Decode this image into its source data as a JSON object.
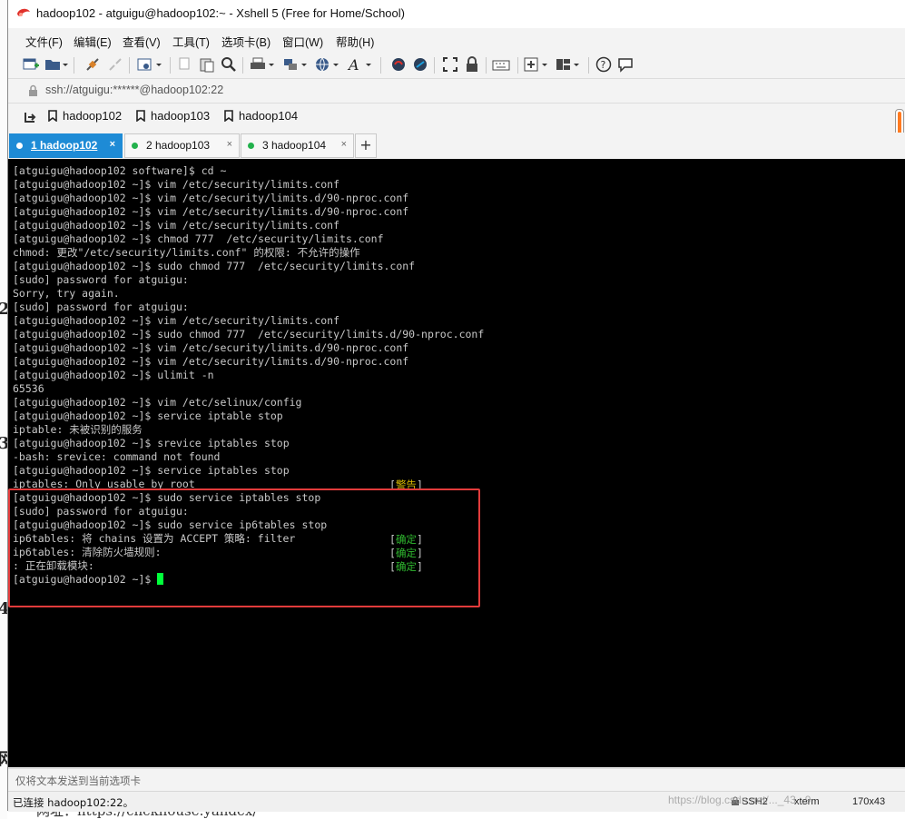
{
  "window": {
    "title": "hadoop102 - atguigu@hadoop102:~ - Xshell 5 (Free for Home/School)"
  },
  "menu": [
    "文件(F)",
    "编辑(E)",
    "查看(V)",
    "工具(T)",
    "选项卡(B)",
    "窗口(W)",
    "帮助(H)"
  ],
  "address": "ssh://atguigu:******@hadoop102:22",
  "links": [
    "hadoop102",
    "hadoop103",
    "hadoop104"
  ],
  "tabs": [
    {
      "label": "1 hadoop102",
      "active": true
    },
    {
      "label": "2 hadoop103",
      "active": false
    },
    {
      "label": "3 hadoop104",
      "active": false
    }
  ],
  "tab_add": "+",
  "tab_close": "×",
  "terminal": {
    "lines": [
      "[atguigu@hadoop102 software]$ cd ~",
      "[atguigu@hadoop102 ~]$ vim /etc/security/limits.conf",
      "[atguigu@hadoop102 ~]$ vim /etc/security/limits.d/90-nproc.conf",
      "[atguigu@hadoop102 ~]$ vim /etc/security/limits.d/90-nproc.conf",
      "[atguigu@hadoop102 ~]$ vim /etc/security/limits.conf",
      "[atguigu@hadoop102 ~]$ chmod 777  /etc/security/limits.conf",
      "chmod: 更改\"/etc/security/limits.conf\" 的权限: 不允许的操作",
      "[atguigu@hadoop102 ~]$ sudo chmod 777  /etc/security/limits.conf",
      "[sudo] password for atguigu:",
      "Sorry, try again.",
      "[sudo] password for atguigu:",
      "[atguigu@hadoop102 ~]$ vim /etc/security/limits.conf",
      "[atguigu@hadoop102 ~]$ sudo chmod 777  /etc/security/limits.d/90-nproc.conf",
      "[atguigu@hadoop102 ~]$ vim /etc/security/limits.d/90-nproc.conf",
      "[atguigu@hadoop102 ~]$ vim /etc/security/limits.d/90-nproc.conf",
      "[atguigu@hadoop102 ~]$ ulimit -n",
      "65536",
      "[atguigu@hadoop102 ~]$ vim /etc/selinux/config",
      "[atguigu@hadoop102 ~]$ service iptable stop",
      "iptable: 未被识别的服务",
      "[atguigu@hadoop102 ~]$ srevice iptables stop",
      "-bash: srevice: command not found",
      "[atguigu@hadoop102 ~]$ service iptables stop",
      "iptables: Only usable by root",
      "[atguigu@hadoop102 ~]$ sudo service iptables stop",
      "[sudo] password for atguigu:",
      "[atguigu@hadoop102 ~]$ sudo service ip6tables stop",
      "ip6tables: 将 chains 设置为 ACCEPT 策略: filter",
      "ip6tables: 清除防火墙规则:",
      ": 正在卸载模块:",
      "[atguigu@hadoop102 ~]$ "
    ],
    "warn_tag": "警告",
    "ok_tag": "确定"
  },
  "send_bar": "仅将文本发送到当前选项卡",
  "status": {
    "connection": "已连接 hadoop102:22。",
    "protocol": "SSH2",
    "terminal_type": "xterm",
    "size": "170x43"
  },
  "watermark": "https://blog.csdn.net/..._43...9",
  "background_text": "网址：https://clickhouse.yandex/"
}
